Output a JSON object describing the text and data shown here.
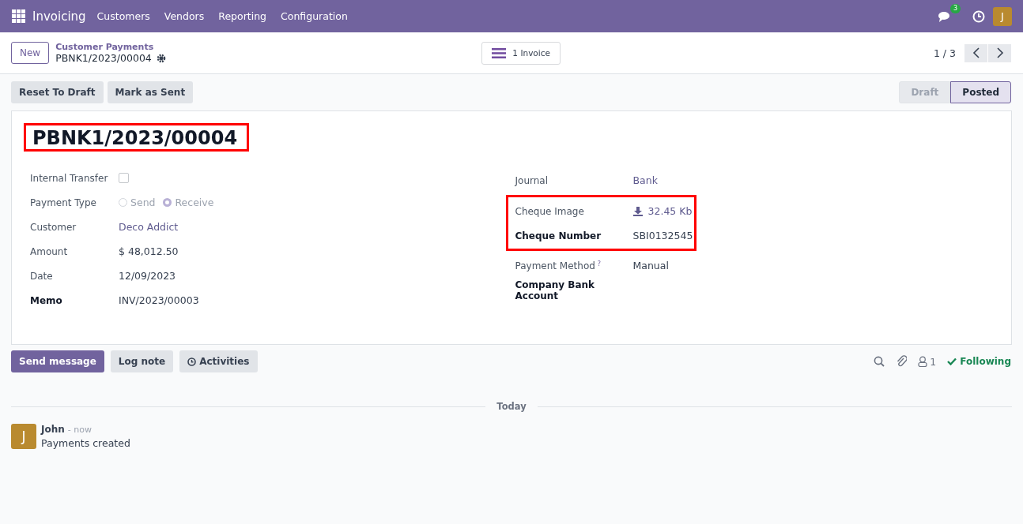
{
  "navbar": {
    "app": "Invoicing",
    "menu": [
      "Customers",
      "Vendors",
      "Reporting",
      "Configuration"
    ],
    "message_count": "3",
    "avatar": "J"
  },
  "control_panel": {
    "new_button": "New",
    "breadcrumb": "Customer Payments",
    "record": "PBNK1/2023/00004",
    "smart_button": "1 Invoice",
    "pager": "1 / 3"
  },
  "actions": [
    "Reset To Draft",
    "Mark as Sent"
  ],
  "status": [
    {
      "label": "Draft",
      "selected": false
    },
    {
      "label": "Posted",
      "selected": true
    }
  ],
  "title": {
    "text": "PBNK1/2023/00004",
    "highlighted": true
  },
  "left_fields": [
    {
      "label": "Internal Transfer",
      "strong": false,
      "kind": "checkbox",
      "checked": false
    },
    {
      "label": "Payment Type",
      "strong": false,
      "kind": "radio",
      "options": [
        {
          "label": "Send",
          "selected": false
        },
        {
          "label": "Receive",
          "selected": true
        }
      ]
    },
    {
      "label": "Customer",
      "strong": false,
      "kind": "link",
      "value": "Deco Addict"
    },
    {
      "label": "Amount",
      "strong": false,
      "kind": "text",
      "value": "$ 48,012.50"
    },
    {
      "label": "Date",
      "strong": false,
      "kind": "text",
      "value": "12/09/2023"
    },
    {
      "label": "Memo",
      "strong": true,
      "kind": "text",
      "value": "INV/2023/00003"
    }
  ],
  "right_groups": [
    {
      "highlighted": false,
      "fields": [
        {
          "label": "Journal",
          "strong": false,
          "kind": "link",
          "value": "Bank"
        }
      ]
    },
    {
      "highlighted": true,
      "fields": [
        {
          "label": "Cheque Image",
          "strong": false,
          "kind": "file",
          "value": "32.45 Kb"
        },
        {
          "label": "Cheque Number",
          "strong": true,
          "kind": "text",
          "value": "SBI0132545"
        }
      ]
    },
    {
      "highlighted": false,
      "fields": [
        {
          "label": "Payment Method",
          "strong": false,
          "kind": "text",
          "help": "?",
          "value": "Manual"
        },
        {
          "label": "Company Bank Account",
          "strong": true,
          "kind": "empty"
        }
      ]
    }
  ],
  "chatter": {
    "buttons": [
      {
        "label": "Send message",
        "selected": true,
        "kind": "plain"
      },
      {
        "label": "Log note",
        "selected": false,
        "kind": "plain"
      },
      {
        "label": "Activities",
        "selected": false,
        "kind": "clock"
      }
    ],
    "followers": "1",
    "following": "Following",
    "separator": "Today",
    "messages": [
      {
        "avatar": "J",
        "author": "John",
        "time": "- now",
        "body": "Payments created"
      }
    ]
  }
}
